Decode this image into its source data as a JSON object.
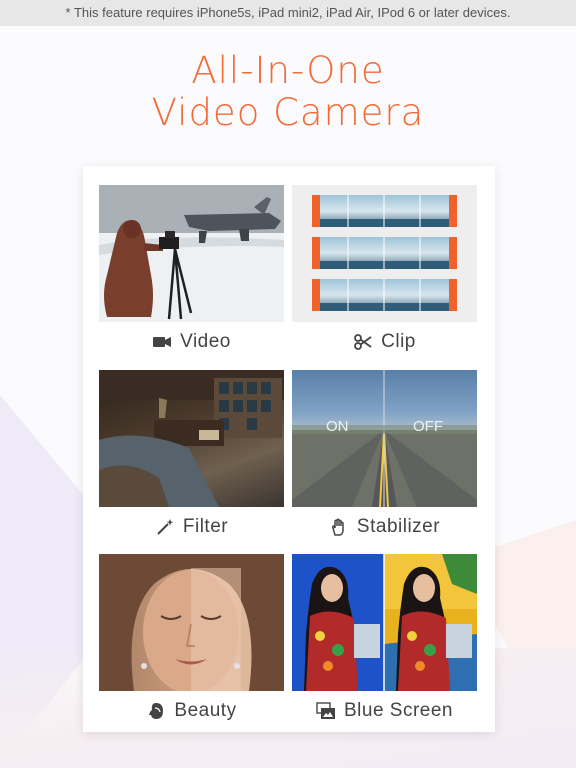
{
  "notice": "* This feature requires iPhone5s, iPad mini2, iPad Air, IPod 6 or later devices.",
  "headline": {
    "line1": "All-In-One",
    "line2": "Video Camera"
  },
  "colors": {
    "accent": "#f26a36",
    "label": "#444444",
    "clip_handle": "#f0622b",
    "blue_screen": "#1d52c9"
  },
  "features": [
    {
      "label": "Video",
      "icon": "video-camera-icon"
    },
    {
      "label": "Clip",
      "icon": "scissors-icon"
    },
    {
      "label": "Filter",
      "icon": "magic-wand-icon"
    },
    {
      "label": "Stabilizer",
      "icon": "hand-icon"
    },
    {
      "label": "Beauty",
      "icon": "face-icon"
    },
    {
      "label": "Blue Screen",
      "icon": "layers-icon"
    }
  ],
  "stabilizer_overlay": {
    "left": "ON",
    "right": "OFF"
  }
}
